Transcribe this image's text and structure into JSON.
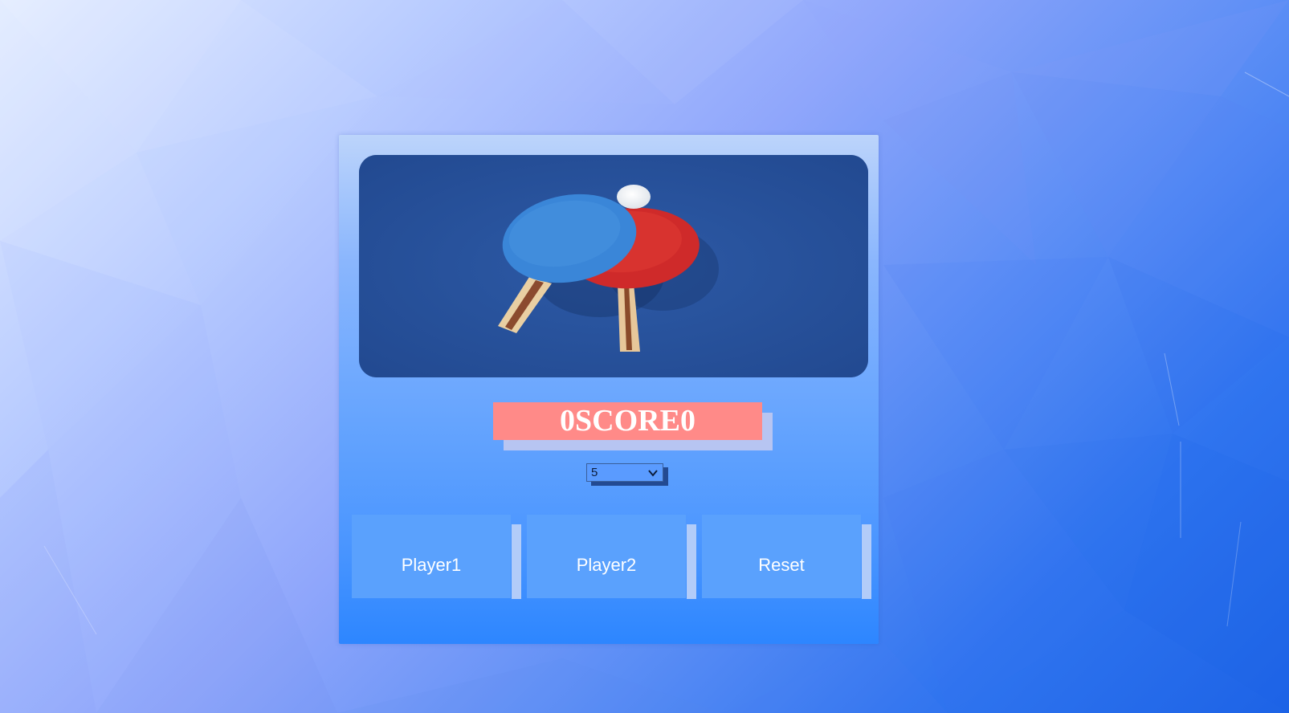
{
  "scoreboard": {
    "player1_score": "0",
    "label": "SCORE",
    "player2_score": "0"
  },
  "winning_score_select": {
    "selected": "5"
  },
  "buttons": {
    "player1": "Player1",
    "player2": "Player2",
    "reset": "Reset"
  },
  "colors": {
    "score_background": "#ff8a88",
    "button_background": "#5aa1fd",
    "hero_background": "#27509a",
    "paddle_blue": "#3a86d8",
    "paddle_red": "#d92e2e"
  },
  "icons": {
    "dropdown": "chevron-down-icon",
    "hero": "ping-pong-paddles-illustration"
  }
}
